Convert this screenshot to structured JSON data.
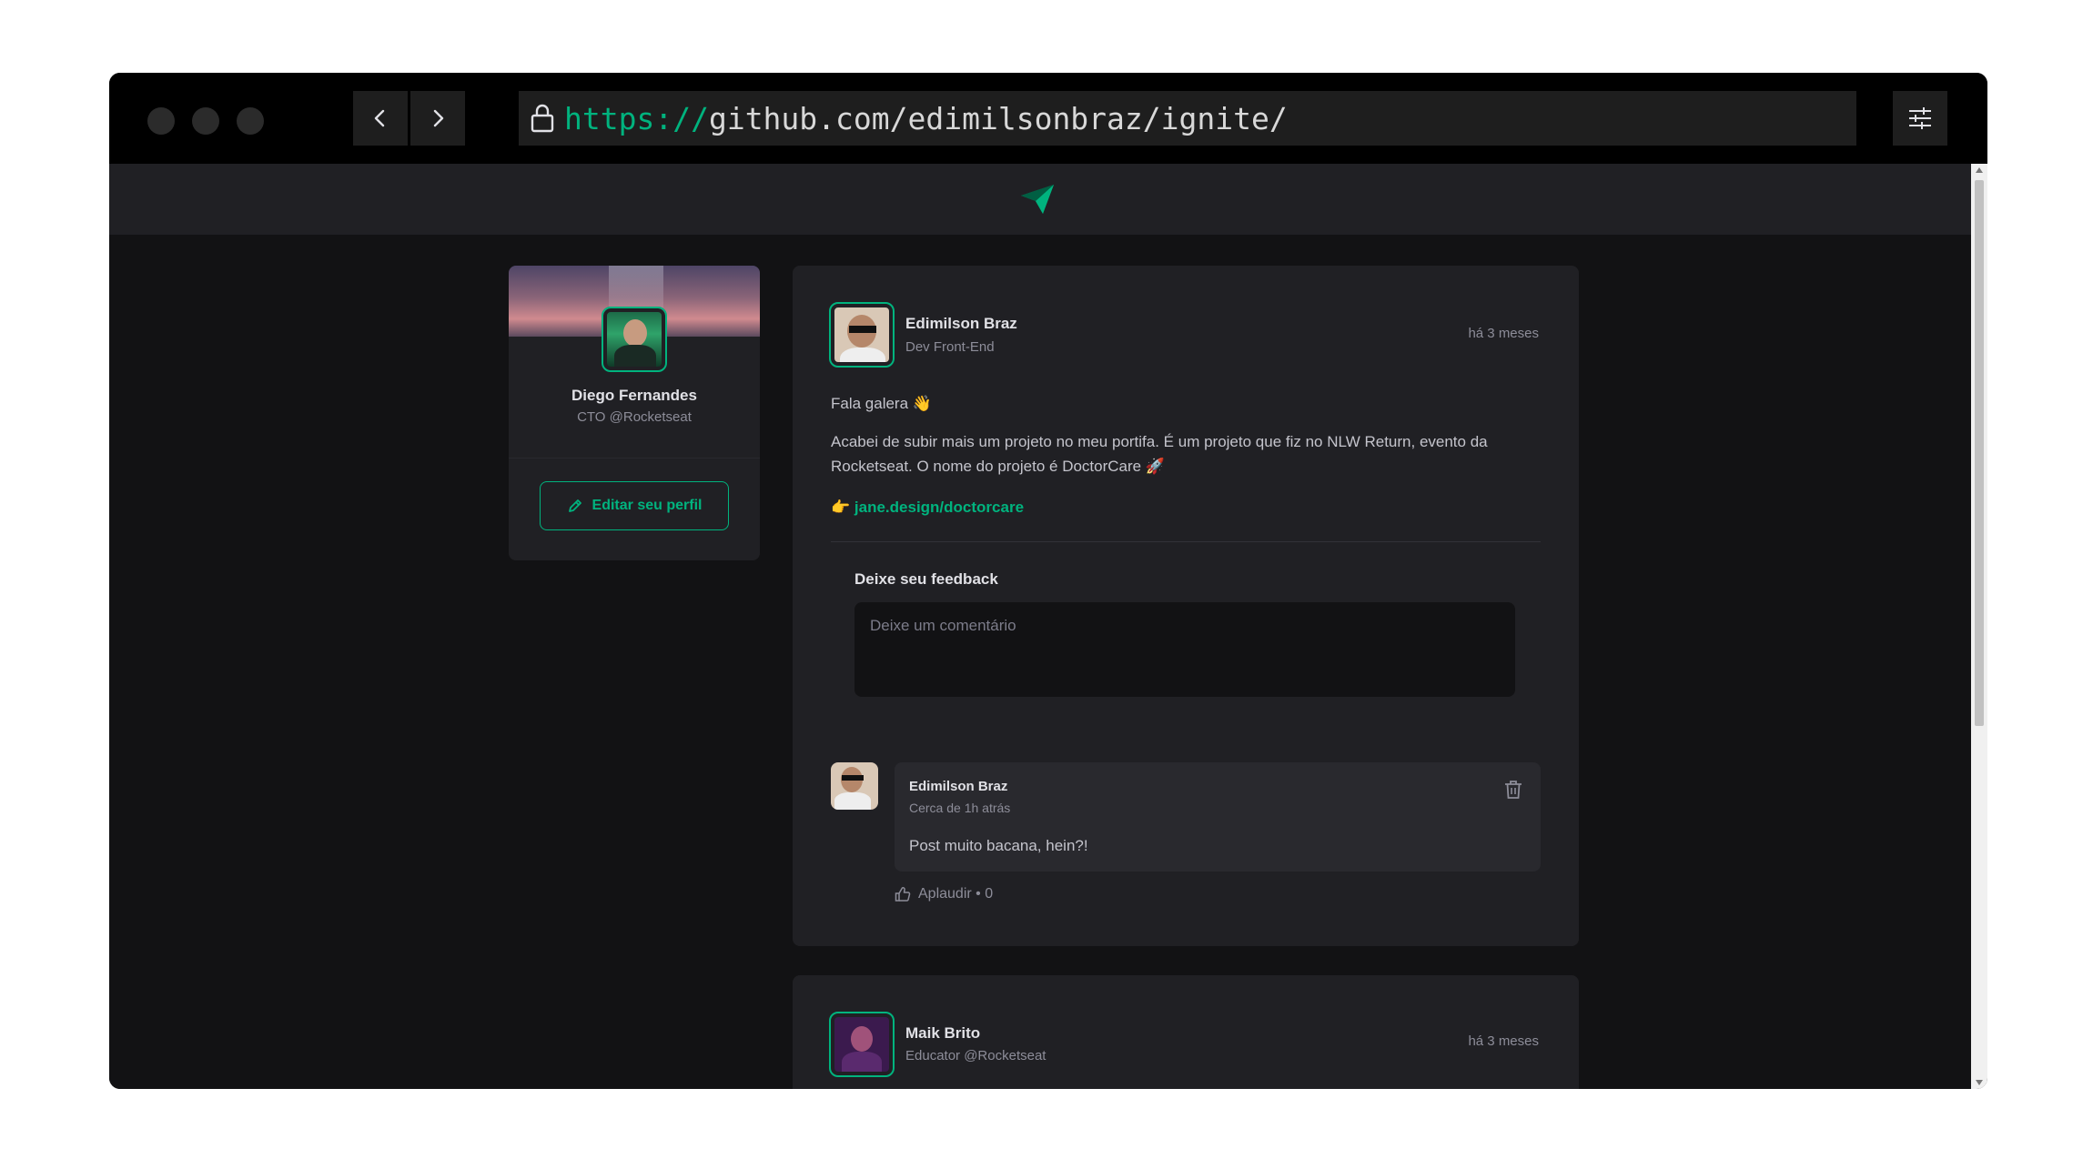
{
  "browser": {
    "url_protocol": "https://",
    "url_rest": "github.com/edimilsonbraz/ignite/",
    "icons": [
      "back-arrow-icon",
      "forward-arrow-icon",
      "lock-icon",
      "sliders-icon"
    ]
  },
  "header": {
    "logo_icon": "paper-plane-icon",
    "accent_color": "#00b37e"
  },
  "profile": {
    "name": "Diego Fernandes",
    "role": "CTO @Rocketseat",
    "edit_label": "Editar seu perfil"
  },
  "posts": [
    {
      "author_name": "Edimilson Braz",
      "author_role": "Dev Front-End",
      "time": "há 3 meses",
      "greeting": "Fala galera 👋",
      "body": "Acabei de subir mais um projeto no meu portifa. É um projeto que fiz no NLW Return, evento da Rocketseat. O nome do projeto é DoctorCare 🚀",
      "link_prefix": "👉",
      "link_text": "jane.design/doctorcare",
      "feedback_title": "Deixe seu feedback",
      "comment_placeholder": "Deixe um comentário",
      "comments": [
        {
          "author": "Edimilson Braz",
          "time": "Cerca de 1h atrás",
          "text": "Post muito bacana, hein?!",
          "applaud": "Aplaudir • 0"
        }
      ]
    },
    {
      "author_name": "Maik Brito",
      "author_role": "Educator @Rocketseat",
      "time": "há 3 meses"
    }
  ]
}
